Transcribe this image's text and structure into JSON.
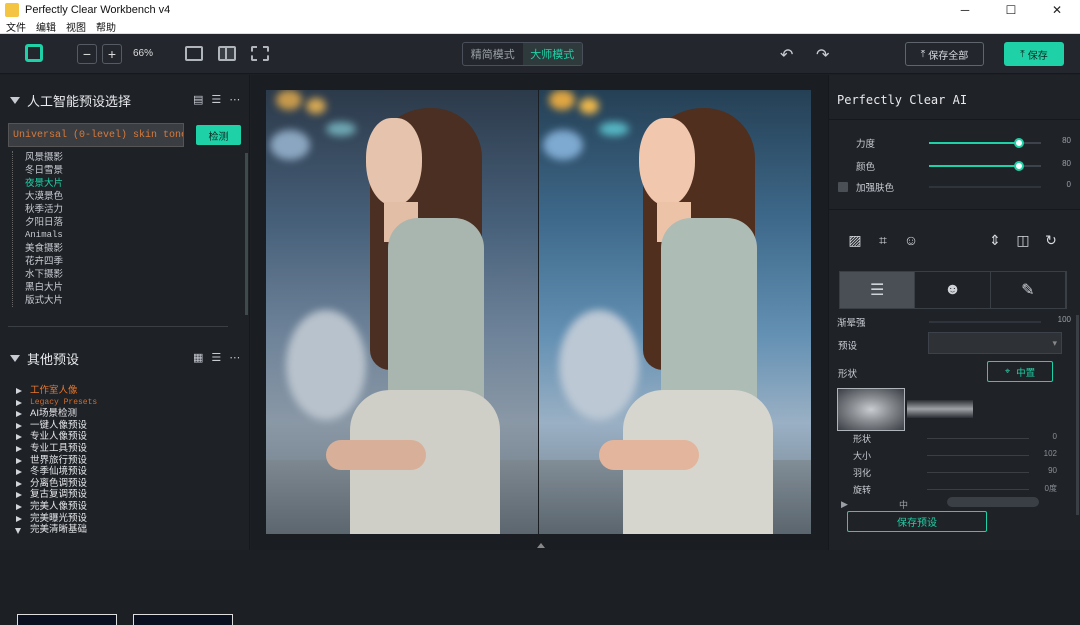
{
  "window": {
    "title": "Perfectly Clear Workbench v4",
    "controls": [
      "─",
      "☐",
      "✕"
    ]
  },
  "menu": [
    "文件",
    "编辑",
    "视图",
    "帮助"
  ],
  "toolbar": {
    "zoom_minus": "−",
    "zoom_plus": "+",
    "zoom": "66%",
    "mode_simple": "精简模式",
    "mode_master": "大师模式",
    "undo": "↶",
    "redo": "↷",
    "save_all": "保存全部",
    "save": "保存",
    "accent": "#1fd1a6"
  },
  "left": {
    "ai_title": "人工智能预设选择",
    "ai_input": "Universal (0-level) skin tone",
    "ai_button": "检测",
    "ai_items": [
      "风景摄影",
      "冬日雪景",
      "夜景大片",
      "大漠景色",
      "秋季活力",
      "夕阳日落",
      "Animals",
      "美食摄影",
      "花卉四季",
      "水下摄影",
      "黑白大片",
      "版式大片"
    ],
    "other_title": "其他预设",
    "other_items": [
      "工作室人像",
      "Legacy Presets",
      "AI场景检测",
      "一键人像预设",
      "专业人像预设",
      "专业工具预设",
      "世界旅行预设",
      "冬季仙境预设",
      "分离色调预设",
      "复古复调预设",
      "完美人像预设",
      "完美曝光预设",
      "完美清晰基础"
    ]
  },
  "right": {
    "title": "Perfectly Clear AI",
    "strength_label": "力度",
    "strength_value": "80",
    "strength": 0.8,
    "color_label": "颜色",
    "color_value": "80",
    "color": 0.8,
    "skin_label": "加强肤色",
    "skin_value": "0",
    "vignette_label": "渐晕强",
    "vignette_value": "100",
    "preset_label": "预设",
    "shape_label": "形状",
    "center_button": "中置",
    "mini": [
      {
        "label": "形状",
        "value": "0"
      },
      {
        "label": "大小",
        "value": "102"
      },
      {
        "label": "羽化",
        "value": "90"
      },
      {
        "label": "旋转",
        "value": "0度"
      }
    ],
    "bottom_label": "中",
    "save_preset": "保存预设"
  }
}
